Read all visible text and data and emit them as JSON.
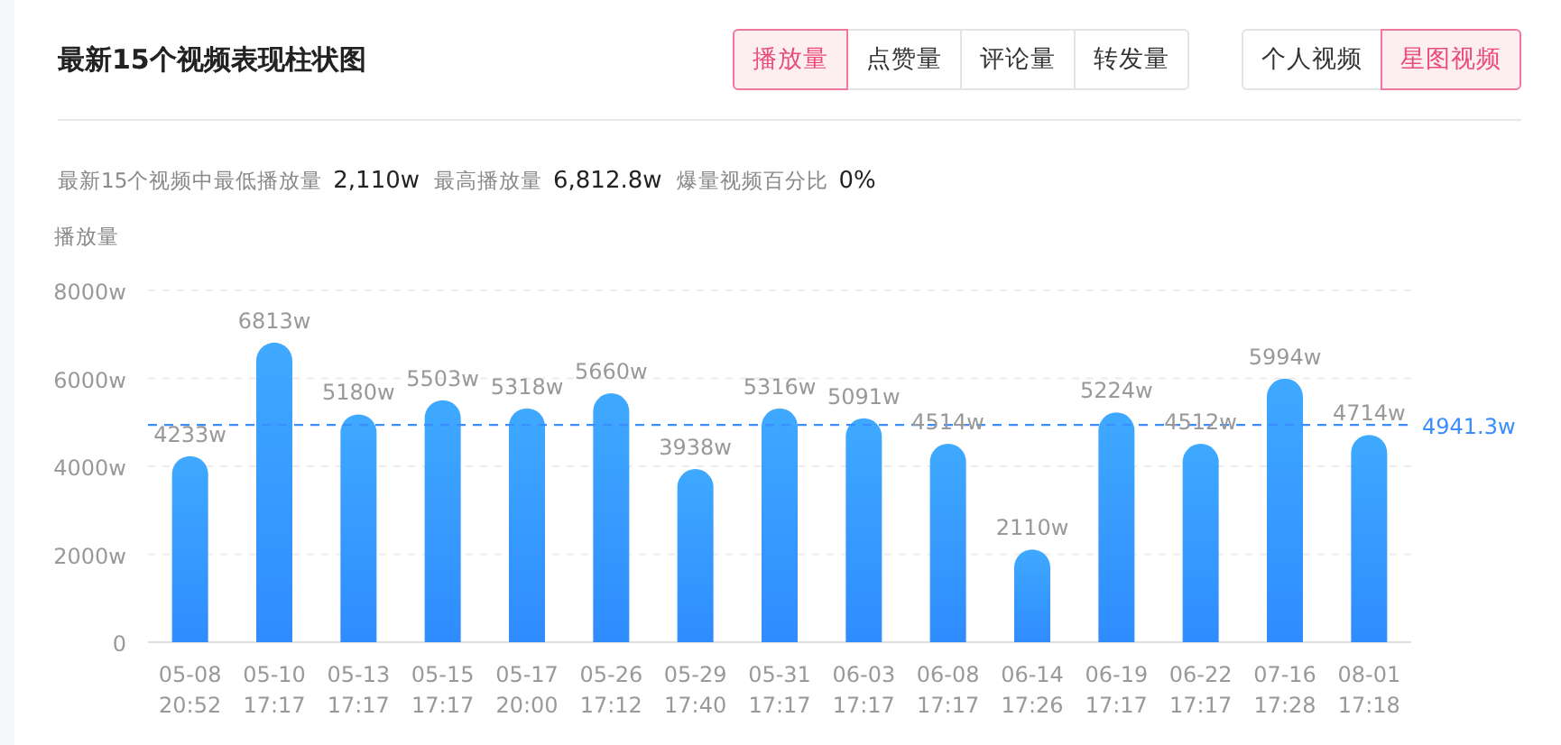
{
  "header": {
    "title": "最新15个视频表现柱状图",
    "metric_tabs": [
      {
        "label": "播放量",
        "selected": true
      },
      {
        "label": "点赞量",
        "selected": false
      },
      {
        "label": "评论量",
        "selected": false
      },
      {
        "label": "转发量",
        "selected": false
      }
    ],
    "source_tabs": [
      {
        "label": "个人视频",
        "selected": false
      },
      {
        "label": "星图视频",
        "selected": true
      }
    ]
  },
  "stats": [
    {
      "label": "最新15个视频中最低播放量",
      "value": "2,110w"
    },
    {
      "label": "最高播放量",
      "value": "6,812.8w"
    },
    {
      "label": "爆量视频百分比",
      "value": "0%"
    }
  ],
  "chart": {
    "chart_data": {
      "type": "bar",
      "ylabel": "播放量",
      "categories": [
        "05-08 20:52",
        "05-10 17:17",
        "05-13 17:17",
        "05-15 17:17",
        "05-17 20:00",
        "05-26 17:12",
        "05-29 17:40",
        "05-31 17:17",
        "06-03 17:17",
        "06-08 17:17",
        "06-14 17:26",
        "06-19 17:17",
        "06-22 17:17",
        "07-16 17:28",
        "08-01 17:18"
      ],
      "grid": true,
      "series": [
        {
          "color": "#2f8cff",
          "values": [
            4233,
            6813,
            5180,
            5503,
            5318,
            5660,
            3938,
            5316,
            5091,
            4514,
            2110,
            5224,
            4512,
            5994,
            4714
          ]
        }
      ],
      "ylim": [
        0,
        8000
      ],
      "yticks": [
        {
          "value": 0,
          "label": "0"
        },
        {
          "value": 2000,
          "label": "2000w"
        },
        {
          "value": 4000,
          "label": "4000w"
        },
        {
          "value": 6000,
          "label": "6000w"
        },
        {
          "value": 8000,
          "label": "8000w"
        }
      ],
      "value_labels": [
        "4233w",
        "6813w",
        "5180w",
        "5503w",
        "5318w",
        "5660w",
        "3938w",
        "5316w",
        "5091w",
        "4514w",
        "2110w",
        "5224w",
        "4512w",
        "5994w",
        "4714w"
      ],
      "ref_lines": [
        {
          "axis": "y",
          "value": 4941.3,
          "label": "4941.3w",
          "color": "#3a8dff"
        }
      ]
    }
  }
}
